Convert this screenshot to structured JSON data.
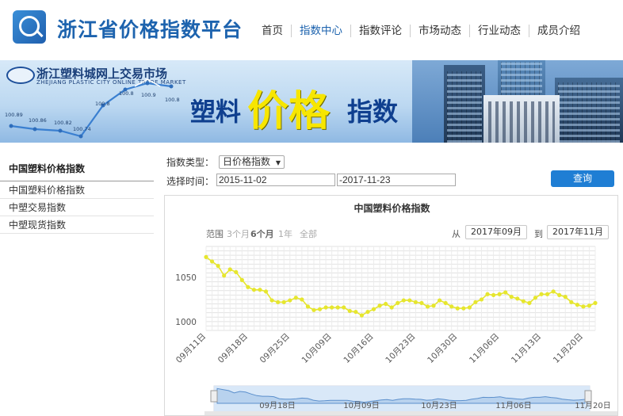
{
  "header": {
    "site_title": "浙江省价格指数平台",
    "nav": [
      {
        "label": "首页"
      },
      {
        "label": "指数中心"
      },
      {
        "label": "指数评论"
      },
      {
        "label": "市场动态"
      },
      {
        "label": "行业动态"
      },
      {
        "label": "成员介绍"
      }
    ],
    "active_nav": "指数中心",
    "accent_color": "#1d63ae"
  },
  "banner": {
    "market_name": "浙江塑料城网上交易市场",
    "market_name_en": "ZHEJIANG PLASTIC CITY ONLINE TRADE MARKET",
    "headline_left": "塑料",
    "headline_mid": "价格",
    "headline_right": "指数",
    "mini_chart_labels": [
      "100.89",
      "100.86",
      "100.82",
      "100.74",
      "100.8",
      "100.8",
      "100.9",
      "100.8"
    ]
  },
  "sidebar": {
    "heading": "中国塑料价格指数",
    "items": [
      {
        "label": "中国塑料价格指数"
      },
      {
        "label": "中塑交易指数"
      },
      {
        "label": "中塑现货指数"
      }
    ]
  },
  "filters": {
    "type_label": "指数类型：",
    "type_value": "日价格指数",
    "time_label": "选择时间：",
    "start_date": "2015-11-02",
    "end_date": "-2017-11-23",
    "query_label": "查询",
    "button_color": "#1f7ed4"
  },
  "chart": {
    "range_label": "范围",
    "ranges": [
      "3个月",
      "6个月",
      "1年",
      "全部"
    ],
    "selected_range": "6个月",
    "from_label": "从",
    "from_value": "2017年09月",
    "to_label": "到",
    "to_value": "2017年11月"
  },
  "chart_data": {
    "type": "line",
    "title": "中国塑料价格指数",
    "xlabel": "",
    "ylabel": "",
    "ytick_labels": [
      "1000",
      "1050"
    ],
    "ylim": [
      990,
      1085
    ],
    "xtick_labels": [
      "09月11日",
      "09月18日",
      "09月25日",
      "10月09日",
      "10月16日",
      "10月23日",
      "10月30日",
      "11月06日",
      "11月13日",
      "11月20日"
    ],
    "xtick_index": [
      0,
      7,
      14,
      21,
      28,
      35,
      42,
      49,
      56,
      63
    ],
    "series": [
      {
        "color": "#e6e62e",
        "values": [
          1073,
          1068,
          1063,
          1052,
          1059,
          1056,
          1047,
          1039,
          1036,
          1036,
          1034,
          1024,
          1022,
          1022,
          1024,
          1027,
          1025,
          1017,
          1013,
          1014,
          1016,
          1016,
          1016,
          1016,
          1012,
          1011,
          1007,
          1011,
          1014,
          1018,
          1020,
          1016,
          1021,
          1024,
          1024,
          1022,
          1021,
          1017,
          1018,
          1024,
          1021,
          1017,
          1015,
          1015,
          1016,
          1022,
          1025,
          1031,
          1030,
          1031,
          1033,
          1028,
          1026,
          1023,
          1021,
          1027,
          1031,
          1031,
          1034,
          1030,
          1028,
          1022,
          1019,
          1017,
          1018,
          1021
        ]
      }
    ],
    "navigator_xtick_labels": [
      "09月18日",
      "10月09日",
      "10月23日",
      "11月06日",
      "11月20日"
    ],
    "grid": true
  }
}
